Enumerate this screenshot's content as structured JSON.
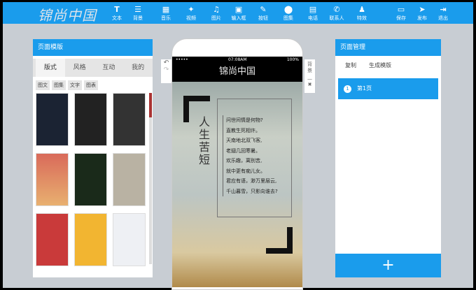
{
  "header": {
    "logo": "锦尚中国",
    "tools": [
      {
        "icon": "T",
        "label": "文本"
      },
      {
        "icon": "☰",
        "label": "背景"
      },
      {
        "icon": "▦",
        "label": "音乐"
      },
      {
        "icon": "✦",
        "label": "视频"
      },
      {
        "icon": "♫",
        "label": "图片"
      },
      {
        "icon": "▣",
        "label": "输入框"
      },
      {
        "icon": "✎",
        "label": "按钮"
      },
      {
        "icon": "⬤",
        "label": "图集"
      },
      {
        "icon": "▤",
        "label": "电话"
      },
      {
        "icon": "✆",
        "label": "联系人"
      },
      {
        "icon": "♟",
        "label": "特效"
      }
    ],
    "actions": [
      {
        "icon": "▭",
        "label": "保存"
      },
      {
        "icon": "➤",
        "label": "发布"
      },
      {
        "icon": "⇥",
        "label": "退出"
      }
    ]
  },
  "left": {
    "title": "页面模版",
    "tabs": [
      "版式",
      "风格",
      "互动",
      "我的"
    ],
    "chips": [
      "图文",
      "图集",
      "文字",
      "图表"
    ]
  },
  "phone": {
    "status_time": "07:08AM",
    "battery": "100%",
    "signal": "•••••",
    "app_title": "锦尚中国",
    "heading": "人生苦短",
    "poem": [
      "问世间情是何物?",
      "直教生死相许。",
      "天南地北双飞客,",
      "老翅几回寒暑。",
      "欢乐趣，离别苦,",
      "就中更有痴儿女。",
      "君应有语，渺万里层云,",
      "千山暮雪，只影向谁去?"
    ]
  },
  "side": {
    "background_label": "背景",
    "minus": "—",
    "close": "✖",
    "undo": "↶",
    "redo": "↷"
  },
  "right": {
    "title": "页面管理",
    "copy": "复制",
    "generate": "生成模版",
    "page_num": "1",
    "page_label": "第1页",
    "add": "+"
  }
}
